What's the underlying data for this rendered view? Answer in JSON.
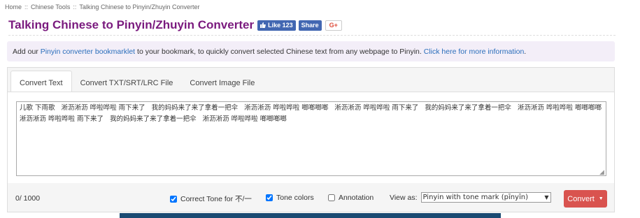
{
  "breadcrumb": {
    "items": [
      "Home",
      "Chinese Tools",
      "Talking Chinese to Pinyin/Zhuyin Converter"
    ],
    "separator": "::"
  },
  "header": {
    "title": "Talking Chinese to Pinyin/Zhuyin Converter",
    "fb_like_label": "Like 123",
    "fb_share_label": "Share",
    "gplus_label": "G+",
    "title_color": "#7a1a7e"
  },
  "info": {
    "text_1": "Add our ",
    "link_1": "Pinyin converter bookmarklet",
    "text_2": " to your bookmark, to quickly convert selected Chinese text from any webpage to Pinyin. ",
    "link_2": "Click here for more information",
    "text_3": "."
  },
  "tabs": [
    {
      "label": "Convert Text",
      "active": true
    },
    {
      "label": "Convert TXT/SRT/LRC File",
      "active": false
    },
    {
      "label": "Convert Image File",
      "active": false
    }
  ],
  "input": {
    "value": "儿歌 下雨歌   淅沥淅沥 哗啦哗啦 雨下来了   我的妈妈来了来了拿着一把伞   淅沥淅沥 哗啦哗啦 啷啷啷啷   淅沥淅沥 哗啦哗啦 雨下来了   我的妈妈来了来了拿着一把伞   淅沥淅沥 哗啦哗啦 啷啷啷啷   淅沥淅沥 哗啦哗啦 雨下来了   我的妈妈来了来了拿着一把伞   淅沥淅沥 哗啦哗啦 啷啷啷啷"
  },
  "footer": {
    "char_count": "0/ 1000",
    "correct_tone_label": "Correct Tone for 不/一",
    "correct_tone_checked": true,
    "tone_colors_label": "Tone colors",
    "tone_colors_checked": true,
    "annotation_label": "Annotation",
    "annotation_checked": false,
    "view_as_label": "View as:",
    "view_as_selected": "Pinyin with tone mark (pīnyīn)",
    "convert_label": "Convert",
    "convert_color": "#d9534f"
  }
}
